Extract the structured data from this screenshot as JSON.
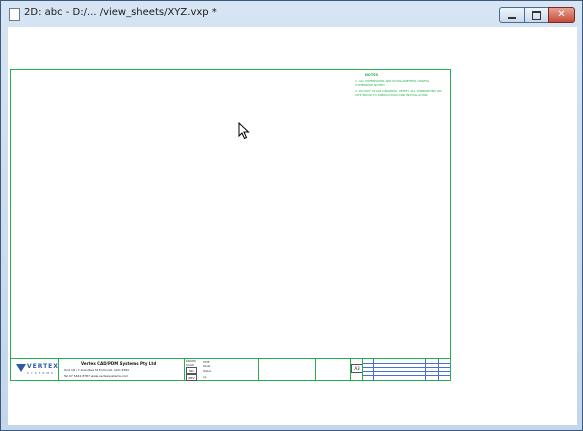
{
  "window": {
    "title": "2D: abc - D:/... /view_sheets/XYZ.vxp *",
    "controls": {
      "close": "✕"
    }
  },
  "sheet": {
    "notes": {
      "heading": "NOTES",
      "lines": [
        "1. ALL DIMENSIONS ARE IN MILLIMETERS UNLESS OTHERWISE NOTED.",
        "2. DO NOT SCALE DRAWING. VERIFY ALL DIMENSIONS ON SITE PRIOR TO FABRICATION AND INSTALLATION."
      ]
    },
    "title_block": {
      "logo_word": "VERTEX",
      "logo_sub": "SYSTEMS",
      "company_name": "Vertex CAD/PDM Systems Pty Ltd",
      "company_address": "Unit 18 / 7 Grevillea St Eumundi, QLD 4562",
      "company_contact": "Tel 07 5442 8787  www.vertexsystems.com",
      "field_drawn": "DRAWN",
      "field_scale": "SCALE",
      "field_date": "DATE",
      "box_size": "A3",
      "box_no": "NO",
      "box_rev": "REV",
      "field_value_1": "Sheet",
      "field_value_2": "Status",
      "field_value_3": "Cp",
      "sheet_size": "A3"
    }
  }
}
